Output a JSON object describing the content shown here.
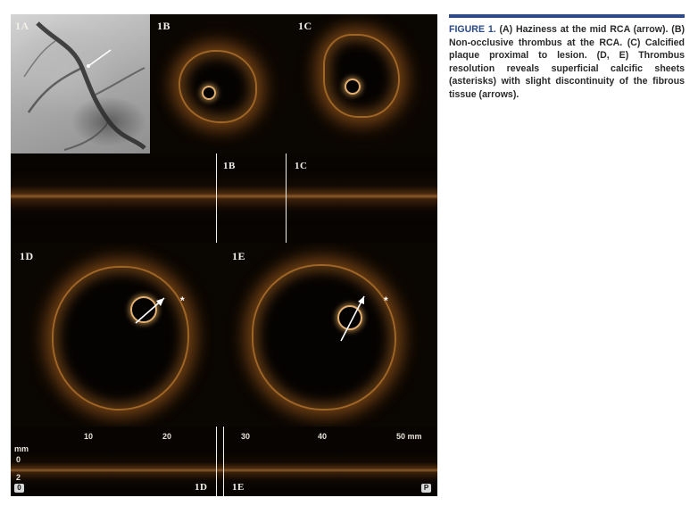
{
  "panels": {
    "a": "1A",
    "b": "1B",
    "c": "1C",
    "d": "1D",
    "e": "1E"
  },
  "long_view_top": {
    "marker_b": "1B",
    "marker_c": "1C"
  },
  "long_view_bottom": {
    "ticks": [
      "10",
      "20",
      "30",
      "40",
      "50 mm"
    ],
    "unit": "mm",
    "depth_ticks": [
      "0",
      "2"
    ],
    "marker_d": "1D",
    "marker_e": "1E",
    "start_badge": "0",
    "end_badge": "P"
  },
  "annotations": {
    "asterisk_d": "*",
    "asterisk_e": "*"
  },
  "caption": {
    "head": "FIGURE 1.",
    "body": " (A) Haziness at the mid RCA (arrow). (B) Non-occlusive thrombus at the RCA. (C) Calcified plaque proximal to lesion. (D, E) Thrombus resolution reveals superficial calcific sheets (asterisks) with slight discontinuity of the fibrous tissue (arrows)."
  },
  "colors": {
    "caption_accent": "#2b4a86",
    "oct_tissue": "#be6e23"
  }
}
